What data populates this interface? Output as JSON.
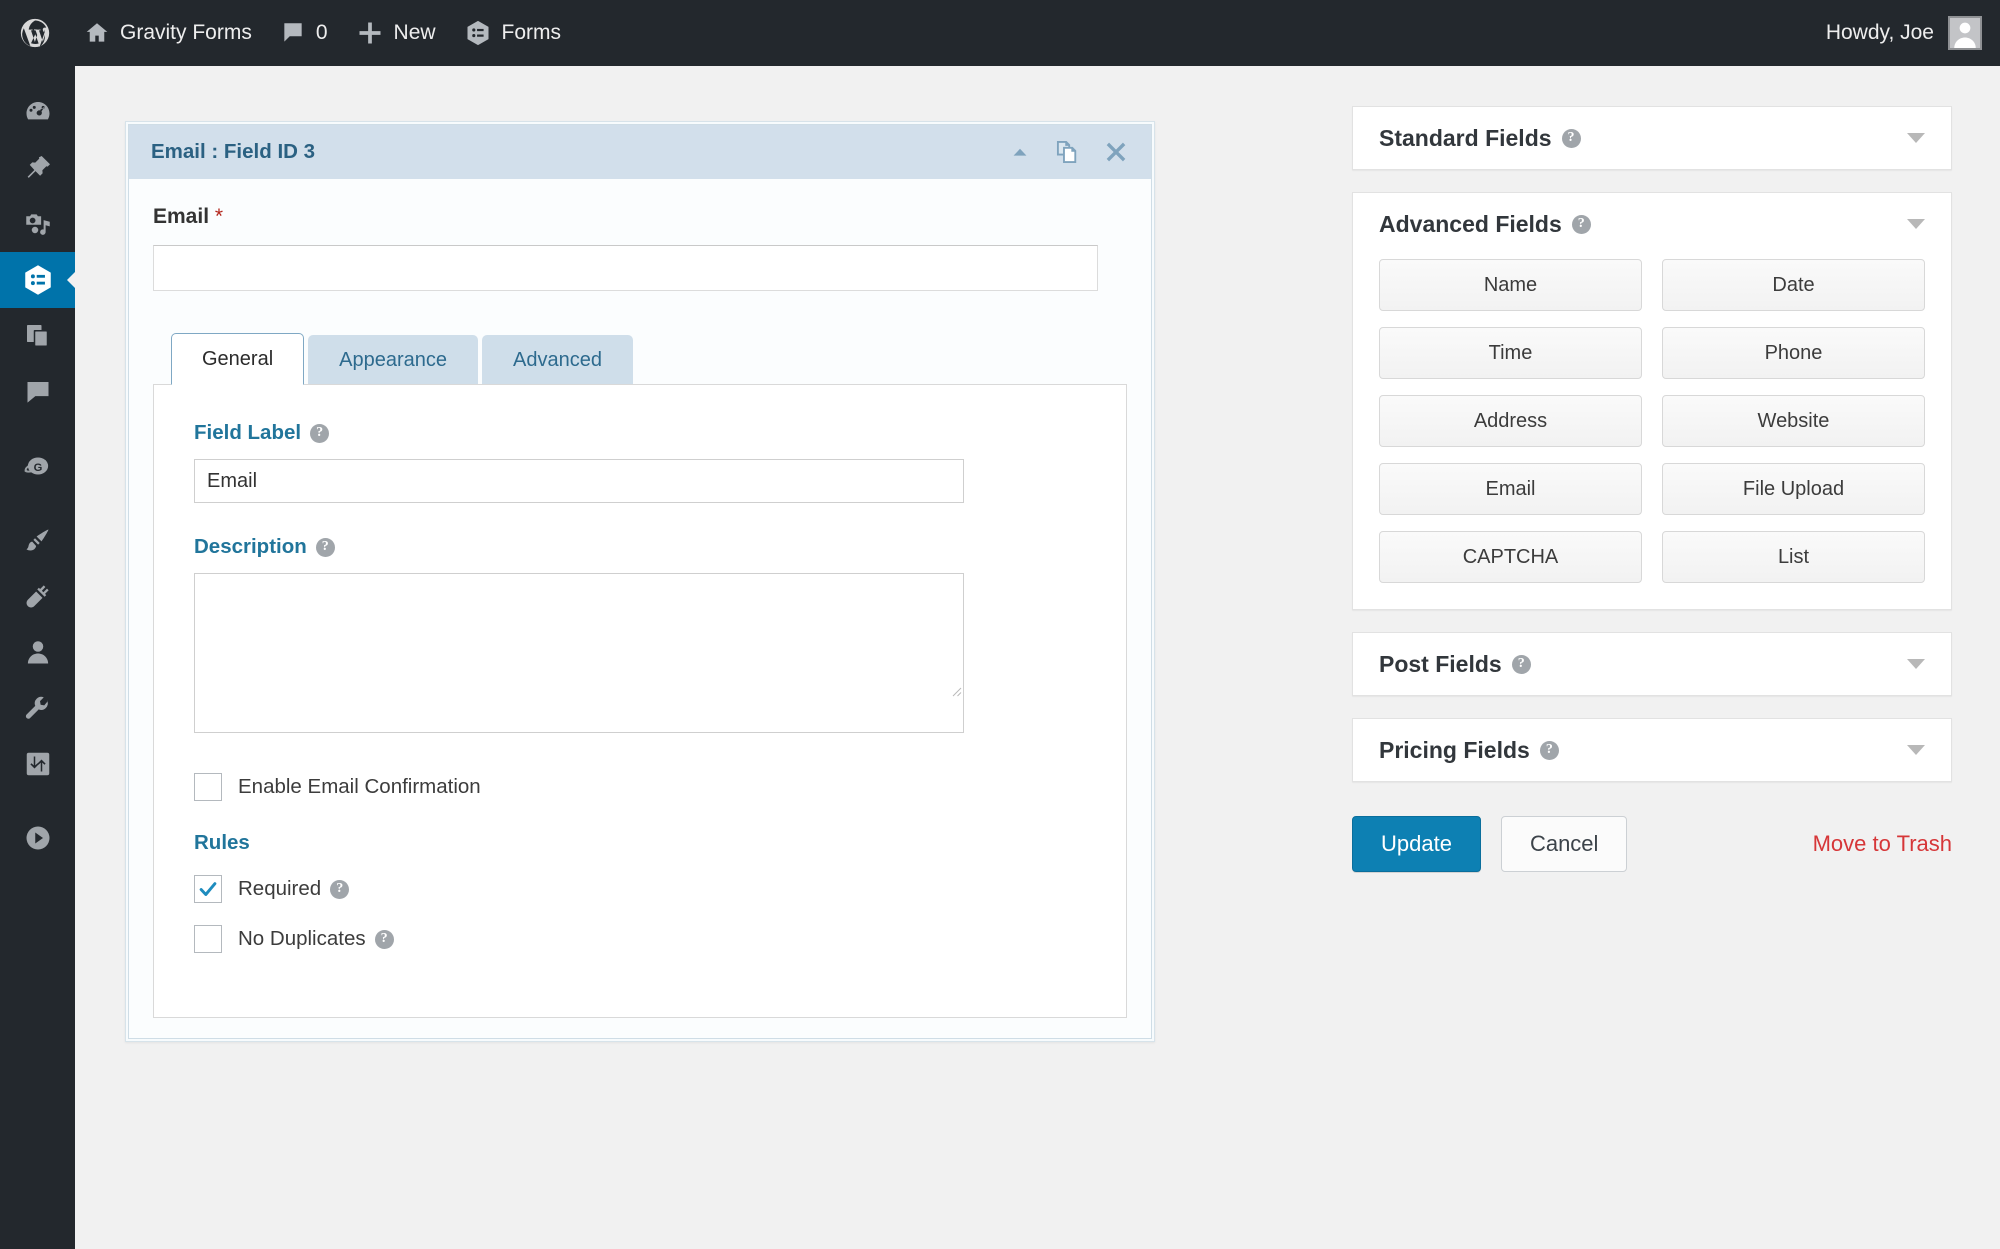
{
  "adminbar": {
    "logo_icon": "wordpress-logo-icon",
    "items": [
      {
        "id": "site-name",
        "label": "Gravity Forms",
        "icon": "home-icon"
      },
      {
        "id": "comments",
        "label": "0",
        "icon": "comment-bubble-icon"
      },
      {
        "id": "new-content",
        "label": "New",
        "icon": "plus-icon"
      },
      {
        "id": "forms",
        "label": "Forms",
        "icon": "gravity-forms-icon"
      }
    ],
    "account_greeting": "Howdy, Joe",
    "avatar_icon": "user-avatar-icon"
  },
  "adminmenu": {
    "items": [
      {
        "id": "dashboard",
        "icon": "dashboard-gauge-icon",
        "current": false
      },
      {
        "id": "posts",
        "icon": "pushpin-icon",
        "current": false
      },
      {
        "id": "media",
        "icon": "media-camera-music-icon",
        "current": false
      },
      {
        "id": "forms",
        "icon": "gravity-forms-icon",
        "current": true
      },
      {
        "id": "pages",
        "icon": "pages-stack-icon",
        "current": false
      },
      {
        "id": "comments",
        "icon": "comment-bubble-icon",
        "current": false
      },
      {
        "id": "gravity-g",
        "icon": "gravity-planet-g-icon",
        "current": false
      },
      {
        "id": "appearance",
        "icon": "paintbrush-icon",
        "current": false
      },
      {
        "id": "plugins",
        "icon": "plug-icon",
        "current": false
      },
      {
        "id": "users",
        "icon": "user-icon",
        "current": false
      },
      {
        "id": "tools",
        "icon": "wrench-icon",
        "current": false
      },
      {
        "id": "settings",
        "icon": "sliders-icon",
        "current": false
      },
      {
        "id": "collapse",
        "icon": "play-circle-icon",
        "current": false
      }
    ]
  },
  "field_editor": {
    "header_title": "Email : Field ID 3",
    "header_icons": [
      {
        "id": "collapse",
        "icon": "caret-up-icon"
      },
      {
        "id": "duplicate",
        "icon": "duplicate-pages-icon"
      },
      {
        "id": "delete",
        "icon": "close-x-icon"
      }
    ],
    "preview": {
      "label": "Email",
      "required_marker": "*",
      "input_value": "",
      "input_placeholder": ""
    },
    "tabs": [
      {
        "id": "general",
        "label": "General",
        "active": true
      },
      {
        "id": "appearance",
        "label": "Appearance",
        "active": false
      },
      {
        "id": "advanced",
        "label": "Advanced",
        "active": false
      }
    ],
    "general": {
      "field_label_heading": "Field Label",
      "field_label_value": "Email",
      "field_label_placeholder": "",
      "description_heading": "Description",
      "description_value": "",
      "description_placeholder": "",
      "enable_email_confirmation": {
        "label": "Enable Email Confirmation",
        "checked": false
      },
      "rules_heading": "Rules",
      "rules": [
        {
          "id": "required",
          "label": "Required",
          "checked": true,
          "has_help": true
        },
        {
          "id": "no-duplicates",
          "label": "No Duplicates",
          "checked": false,
          "has_help": true
        }
      ]
    }
  },
  "sidebar": {
    "panels": [
      {
        "id": "standard-fields",
        "title": "Standard Fields",
        "collapsed": true,
        "buttons": []
      },
      {
        "id": "advanced-fields",
        "title": "Advanced Fields",
        "collapsed": false,
        "buttons": [
          "Name",
          "Date",
          "Time",
          "Phone",
          "Address",
          "Website",
          "Email",
          "File Upload",
          "CAPTCHA",
          "List"
        ]
      },
      {
        "id": "post-fields",
        "title": "Post Fields",
        "collapsed": true,
        "buttons": []
      },
      {
        "id": "pricing-fields",
        "title": "Pricing Fields",
        "collapsed": true,
        "buttons": []
      }
    ],
    "actions": {
      "update_label": "Update",
      "cancel_label": "Cancel",
      "trash_label": "Move to Trash"
    }
  },
  "colors": {
    "admin_dark": "#23282d",
    "accent_blue": "#0073aa",
    "primary_button": "#0d80b3",
    "link_blue": "#21759b",
    "danger_red": "#d63638",
    "required_star": "#b3271d",
    "panel_header_blue": "#d2dfeb"
  }
}
